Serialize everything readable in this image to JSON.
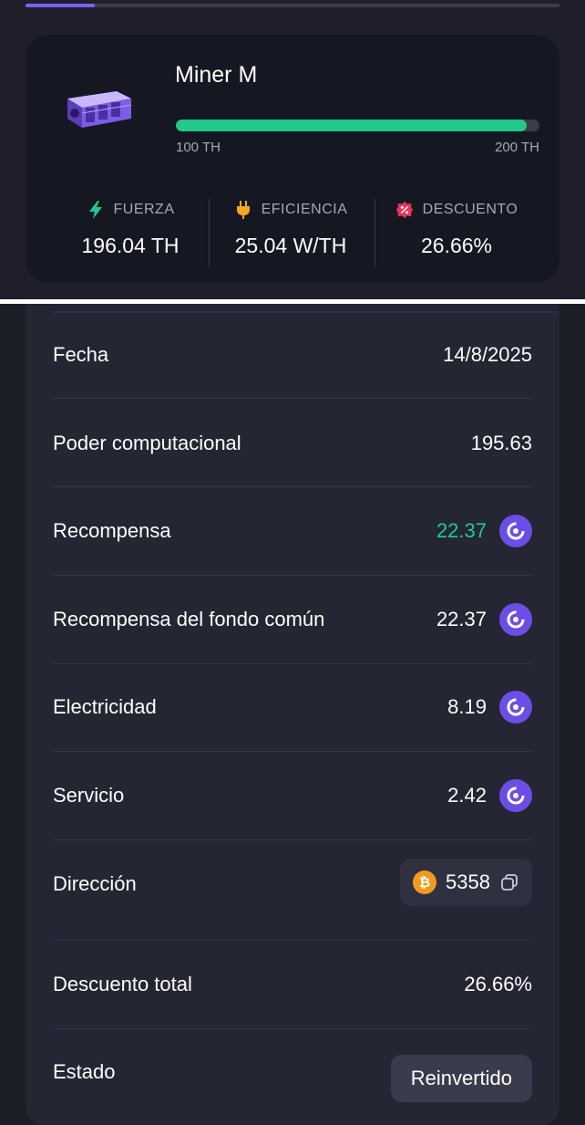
{
  "top_progress": {
    "fraction": 0.13
  },
  "miner": {
    "name": "Miner M",
    "image_icon": "miner-device-icon",
    "range": {
      "min_label": "100 TH",
      "max_label": "200 TH",
      "fill_fraction": 0.965
    },
    "stats": [
      {
        "label": "FUERZA",
        "value": "196.04 TH",
        "icon": "lightning-icon",
        "icon_color": "#22c98b"
      },
      {
        "label": "EFICIENCIA",
        "value": "25.04 W/TH",
        "icon": "plug-icon",
        "icon_color": "#f5a623"
      },
      {
        "label": "DESCUENTO",
        "value": "26.66%",
        "icon": "discount-badge-icon",
        "icon_color": "#e8345a"
      }
    ]
  },
  "details": {
    "rows": [
      {
        "label": "Fecha",
        "value": "14/8/2025"
      },
      {
        "label": "Poder computacional",
        "value": "195.63"
      },
      {
        "label": "Recompensa",
        "value": "22.37",
        "icon": "gomining-coin-icon",
        "value_color": "#22c98b"
      },
      {
        "label": "Recompensa del fondo común",
        "value": "22.37",
        "icon": "gomining-coin-icon"
      },
      {
        "label": "Electricidad",
        "value": "8.19",
        "icon": "gomining-coin-icon"
      },
      {
        "label": "Servicio",
        "value": "2.42",
        "icon": "gomining-coin-icon"
      },
      {
        "label": "Dirección",
        "value": "5358",
        "icon": "bitcoin-icon",
        "action_icon": "copy-icon"
      },
      {
        "label": "Descuento total",
        "value": "26.66%"
      },
      {
        "label": "Estado",
        "value": "Reinvertido"
      }
    ]
  },
  "colors": {
    "accent_green": "#22c98b",
    "accent_purple": "#6c4ee6",
    "bitcoin_orange": "#f39a1e",
    "card_bg": "#242634"
  }
}
